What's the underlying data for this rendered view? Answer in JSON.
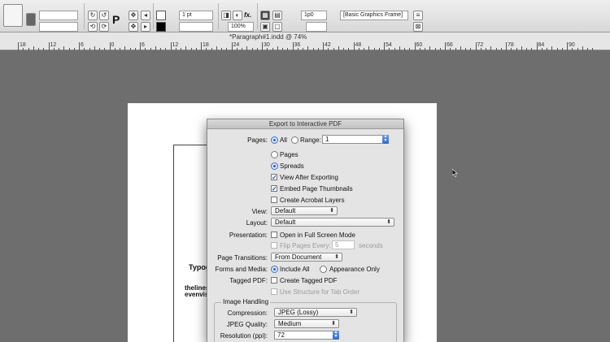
{
  "control_panel": {
    "stroke_weight": "1 pt",
    "zoom_percent": "100%",
    "offset_value": "1p0",
    "object_style": "[Basic Graphics Frame]",
    "fx_label": "fx.",
    "p_label": "P"
  },
  "document_tab": {
    "title": "*Paragraph#1.indd @ 74%"
  },
  "ruler": {
    "numbers": [
      "18",
      "12",
      "6",
      "0",
      "6",
      "12",
      "18",
      "24",
      "30",
      "36",
      "42",
      "48",
      "54",
      "60",
      "66",
      "72",
      "78",
      "84",
      "90"
    ]
  },
  "page": {
    "typo_fragment": "Typog",
    "text_line_1": "thelinesp",
    "text_line_2": "evenvis"
  },
  "dialog": {
    "title": "Export to Interactive PDF",
    "pages": {
      "label": "Pages:",
      "all_label": "All",
      "range_label": "Range:",
      "range_value": "1",
      "pages_option": "Pages",
      "spreads_option": "Spreads",
      "view_after_exporting": "View After Exporting",
      "embed_thumbnails": "Embed Page Thumbnails",
      "create_layers": "Create Acrobat Layers"
    },
    "view": {
      "label": "View:",
      "value": "Default"
    },
    "layout": {
      "label": "Layout:",
      "value": "Default"
    },
    "presentation": {
      "label": "Presentation:",
      "full_screen": "Open in Full Screen Mode",
      "flip_pages": "Flip Pages Every:",
      "flip_value": "5",
      "seconds": "seconds"
    },
    "page_transitions": {
      "label": "Page Transitions:",
      "value": "From Document"
    },
    "forms_media": {
      "label": "Forms and Media:",
      "include_all": "Include All",
      "appearance_only": "Appearance Only"
    },
    "tagged_pdf": {
      "label": "Tagged PDF:",
      "create_tagged": "Create Tagged PDF",
      "use_structure": "Use Structure for Tab Order"
    },
    "image_handling": {
      "title": "Image Handling",
      "compression_label": "Compression:",
      "compression_value": "JPEG (Lossy)",
      "quality_label": "JPEG Quality:",
      "quality_value": "Medium",
      "resolution_label": "Resolution (ppi):",
      "resolution_value": "72"
    }
  }
}
